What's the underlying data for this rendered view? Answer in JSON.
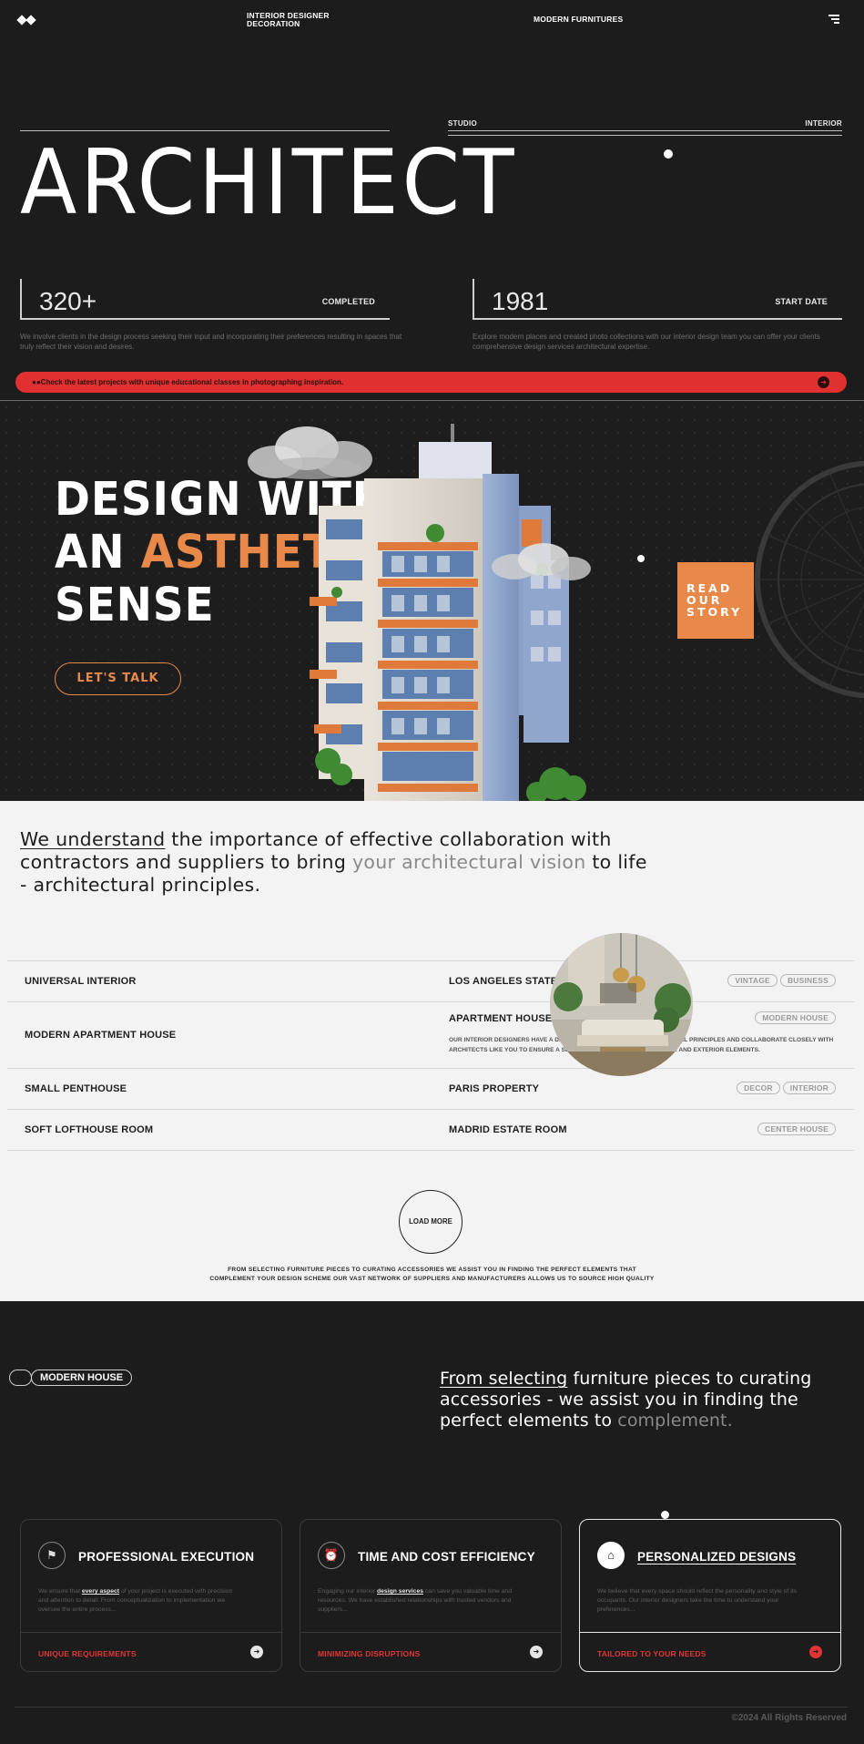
{
  "nav": {
    "brand_line1": "INTERIOR DESIGNER",
    "brand_line2": "DECORATION",
    "center_link": "MODERN FURNITURES",
    "menu_icon": "menu-icon",
    "logo_icon": "diamond-logo-icon"
  },
  "hero": {
    "label_left": "STUDIO",
    "label_right": "INTERIOR",
    "title": "ARCHITECT",
    "stats": [
      {
        "number": "320+",
        "label": "COMPLETED",
        "description": "We involve clients in the design process seeking their input and incorporating their preferences resulting in spaces that truly reflect their vision and desires."
      },
      {
        "number": "1981",
        "label": "START DATE",
        "description": "Explore modern places and created photo collections with our interior design team you can offer your clients comprehensive design services architectural expertise."
      }
    ],
    "banner_text": "●●Check the latest projects with unique educational classes in photographing inspiration.",
    "banner_icon": "arrow-right-icon"
  },
  "design": {
    "headline_line1": "DESIGN WITH",
    "headline_line2a": "AN ",
    "headline_line2b": "ASTHETIC",
    "headline_line3": "SENSE",
    "talk_button": "LET'S TALK",
    "story_line1": "READ",
    "story_line2": "OUR",
    "story_line3": "STORY"
  },
  "collab": {
    "quote_ul": "We understand",
    "quote_a": " the importance of effective collaboration with contractors and suppliers to bring ",
    "quote_muted": "your architectural vision",
    "quote_b": " to life - architectural principles.",
    "rows": [
      {
        "left": "UNIVERSAL INTERIOR",
        "right": "LOS ANGELES STATE",
        "tags": [
          "VINTAGE",
          "BUSINESS"
        ]
      },
      {
        "left": "MODERN APARTMENT HOUSE",
        "right": "APARTMENT HOUSE - NEW YORK",
        "tags": [
          "MODERN HOUSE"
        ],
        "description": "OUR INTERIOR DESIGNERS HAVE A DEEP UNDERSTANDING OF ARCHITECTURAL PRINCIPLES AND COLLABORATE CLOSELY WITH ARCHITECTS LIKE YOU TO ENSURE A SEAMLESS INTEGRATION OF INTERIOR AND EXTERIOR ELEMENTS."
      },
      {
        "left": "SMALL PENTHOUSE",
        "right": "PARIS PROPERTY",
        "tags": [
          "DECOR",
          "INTERIOR"
        ]
      },
      {
        "left": "SOFT LOFTHOUSE ROOM",
        "right": "MADRID ESTATE ROOM",
        "tags": [
          "CENTER HOUSE"
        ]
      }
    ],
    "load_more": "LOAD MORE",
    "caption_line1": "FROM SELECTING FURNITURE PIECES TO CURATING ACCESSORIES  WE ASSIST YOU IN FINDING THE PERFECT ELEMENTS THAT",
    "caption_line2": "COMPLEMENT YOUR DESIGN SCHEME  OUR VAST NETWORK OF SUPPLIERS AND MANUFACTURERS ALLOWS US TO SOURCE HIGH  QUALITY"
  },
  "services": {
    "pill": "MODERN HOUSE",
    "quote_ul": "From selecting",
    "quote_a": " furniture pieces to curating accessories - we assist you in finding the perfect elements to ",
    "quote_muted": "complement.",
    "cards": [
      {
        "icon": "bookmark-icon",
        "title": "PROFESSIONAL EXECUTION",
        "text_a": "We ensure that ",
        "text_hl": "every aspect",
        "text_b": " of your project is executed with precision and attention to detail. From conceptualization to implementation we oversee the entire process...",
        "link": "UNIQUE REQUIREMENTS"
      },
      {
        "icon": "alarm-clock-icon",
        "title": "TIME AND COST EFFICIENCY",
        "text_a": "Engaging our interior ",
        "text_hl": "design services",
        "text_b": " can save you valuable time and resources. We have established relationships with trusted vendors and suppliers...",
        "link": "MINIMIZING DISRUPTIONS"
      },
      {
        "icon": "home-icon",
        "title": "PERSONALIZED DESIGNS",
        "text_a": "We believe that every space should reflect the personality and style of its occupants. Our interior designers take the time to understand your preferences...",
        "text_hl": "",
        "text_b": "",
        "link": "TAILORED TO YOUR NEEDS"
      }
    ]
  },
  "footer": {
    "copyright": "©2024 All Rights Reserved"
  },
  "colors": {
    "background": "#1c1c1c",
    "accent_orange": "#e8894a",
    "accent_red": "#e03030",
    "light_section": "#f3f3f3"
  }
}
